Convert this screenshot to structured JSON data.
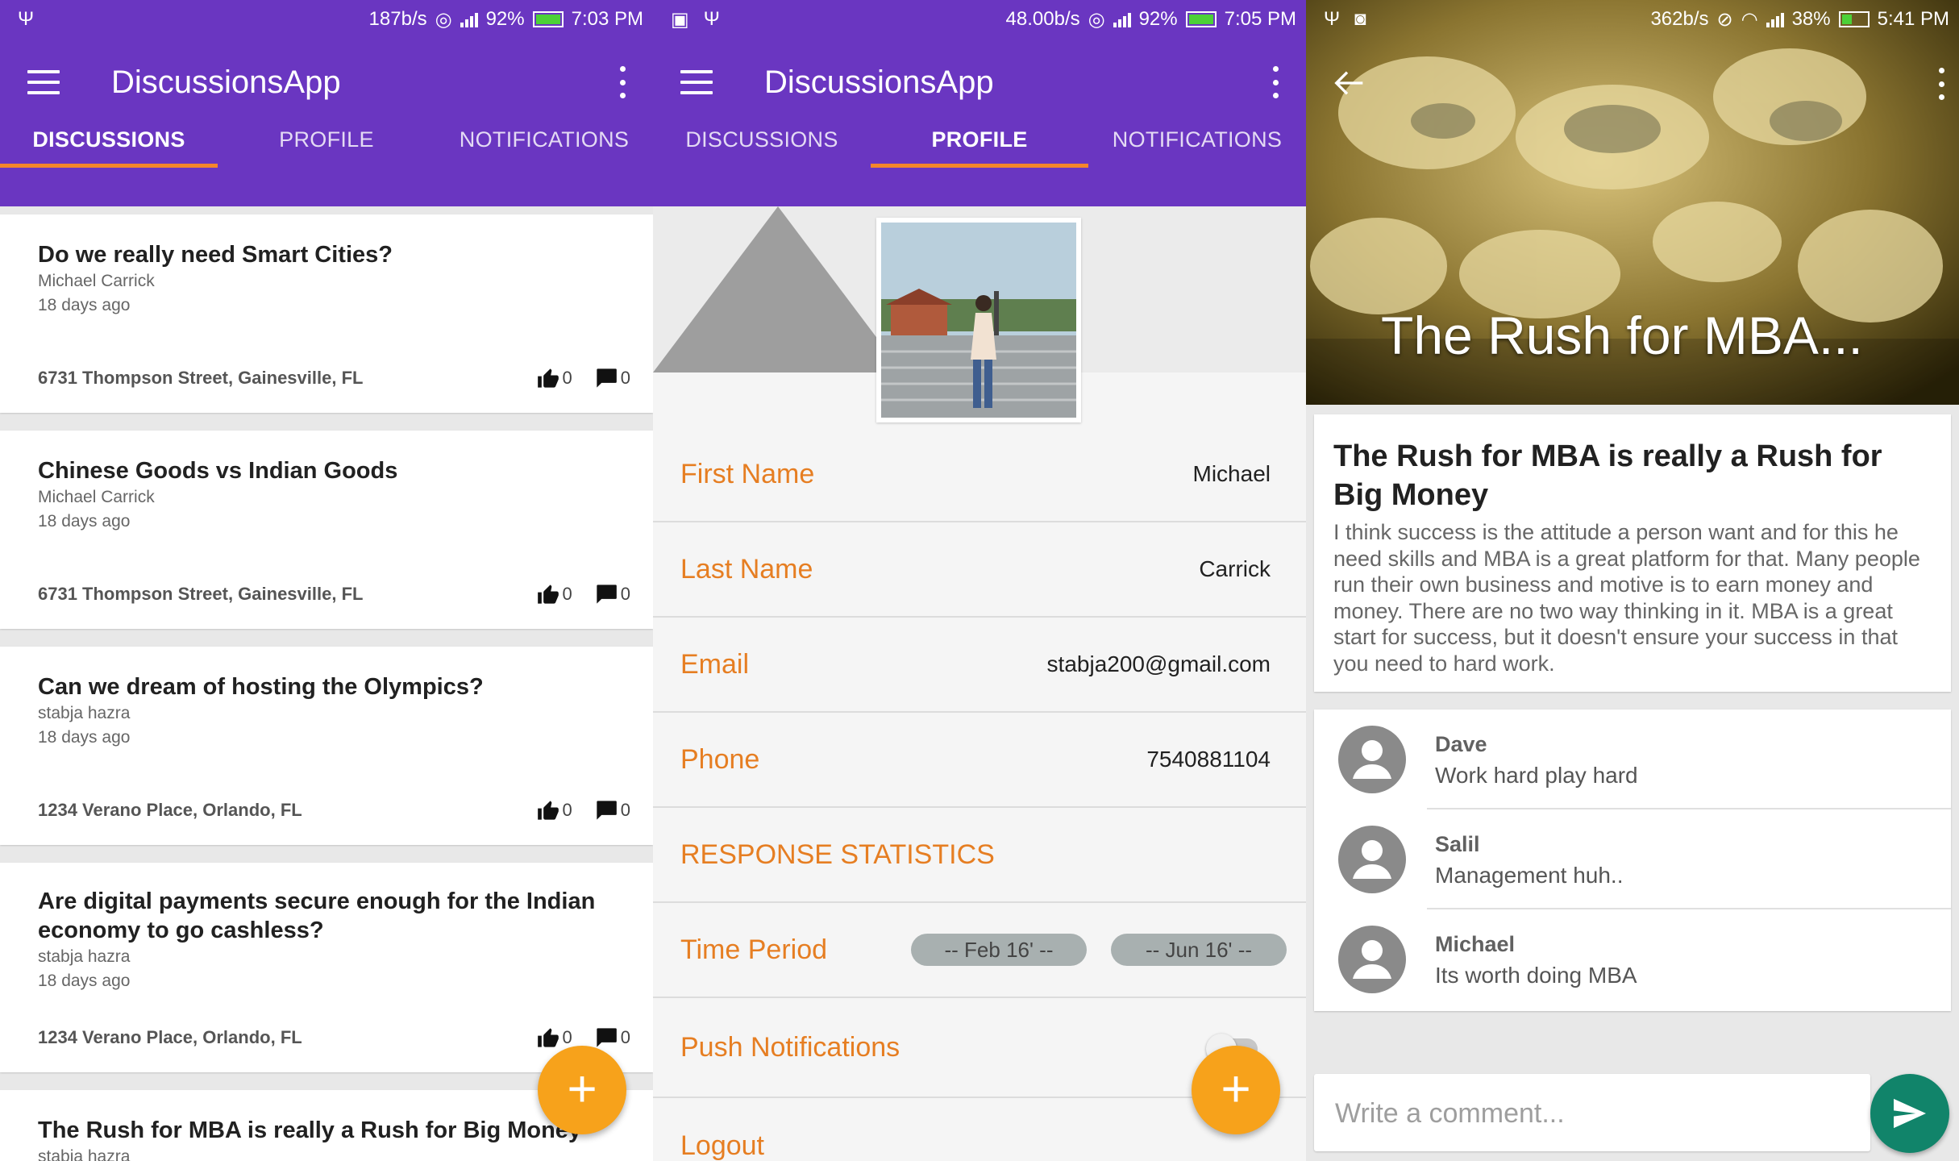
{
  "screens": {
    "discussions": {
      "status": {
        "speed": "187b/s",
        "battery": "92%",
        "time": "7:03 PM"
      },
      "app_title": "DiscussionsApp",
      "tabs": [
        "DISCUSSIONS",
        "PROFILE",
        "NOTIFICATIONS"
      ],
      "active_tab": "DISCUSSIONS",
      "discussions": [
        {
          "title": "Do we really need Smart Cities?",
          "author": "Michael Carrick",
          "time": "18 days ago",
          "address": "6731 Thompson Street, Gainesville, FL",
          "likes": "0",
          "comments": "0"
        },
        {
          "title": "Chinese Goods vs Indian Goods",
          "author": "Michael Carrick",
          "time": "18 days ago",
          "address": "6731 Thompson Street, Gainesville, FL",
          "likes": "0",
          "comments": "0"
        },
        {
          "title": "Can we dream of hosting the Olympics?",
          "author": "stabja hazra",
          "time": "18 days ago",
          "address": "1234 Verano Place, Orlando, FL",
          "likes": "0",
          "comments": "0"
        },
        {
          "title": "Are digital payments secure enough for the Indian economy to go cashless?",
          "author": "stabja hazra",
          "time": "18 days ago",
          "address": "1234 Verano Place, Orlando, FL",
          "likes": "0",
          "comments": "0"
        },
        {
          "title": "The Rush for MBA is really a Rush for Big Money",
          "author": "stabja hazra"
        }
      ],
      "fab": "+"
    },
    "profile": {
      "status": {
        "speed": "48.00b/s",
        "battery": "92%",
        "time": "7:05 PM"
      },
      "app_title": "DiscussionsApp",
      "tabs": [
        "DISCUSSIONS",
        "PROFILE",
        "NOTIFICATIONS"
      ],
      "active_tab": "PROFILE",
      "fields": [
        {
          "label": "First Name",
          "value": "Michael"
        },
        {
          "label": "Last Name",
          "value": "Carrick"
        },
        {
          "label": "Email",
          "value": "stabja200@gmail.com"
        },
        {
          "label": "Phone",
          "value": "7540881104"
        }
      ],
      "section_heading": "RESPONSE STATISTICS",
      "time_period": {
        "label": "Time Period",
        "from": "-- Feb 16' --",
        "to": "-- Jun 16' --"
      },
      "push_notifications": {
        "label": "Push Notifications",
        "enabled": false
      },
      "logout": "Logout",
      "fab": "+"
    },
    "detail": {
      "status": {
        "speed": "362b/s",
        "battery": "38%",
        "time": "5:41 PM"
      },
      "hero_title": "The Rush for MBA...",
      "title": "The Rush for MBA is really a Rush for Big Money",
      "body": "I think success is the attitude a person want and for this he need skills and MBA is a great platform for that. Many people run their own business and motive is to earn money and money. There are no two way thinking in it. MBA is a great start for success, but it doesn't ensure your success in that you need to hard work.",
      "comments": [
        {
          "name": "Dave",
          "text": "Work hard play hard"
        },
        {
          "name": "Salil",
          "text": "Management huh.."
        },
        {
          "name": "Michael",
          "text": "Its worth doing MBA"
        }
      ],
      "comment_placeholder": "Write a comment..."
    }
  },
  "colors": {
    "primary": "#6a36c1",
    "tab_indicator": "#f5862b",
    "accent_orange": "#e67e22",
    "fab": "#f7a21b",
    "send_button": "#11846a"
  }
}
